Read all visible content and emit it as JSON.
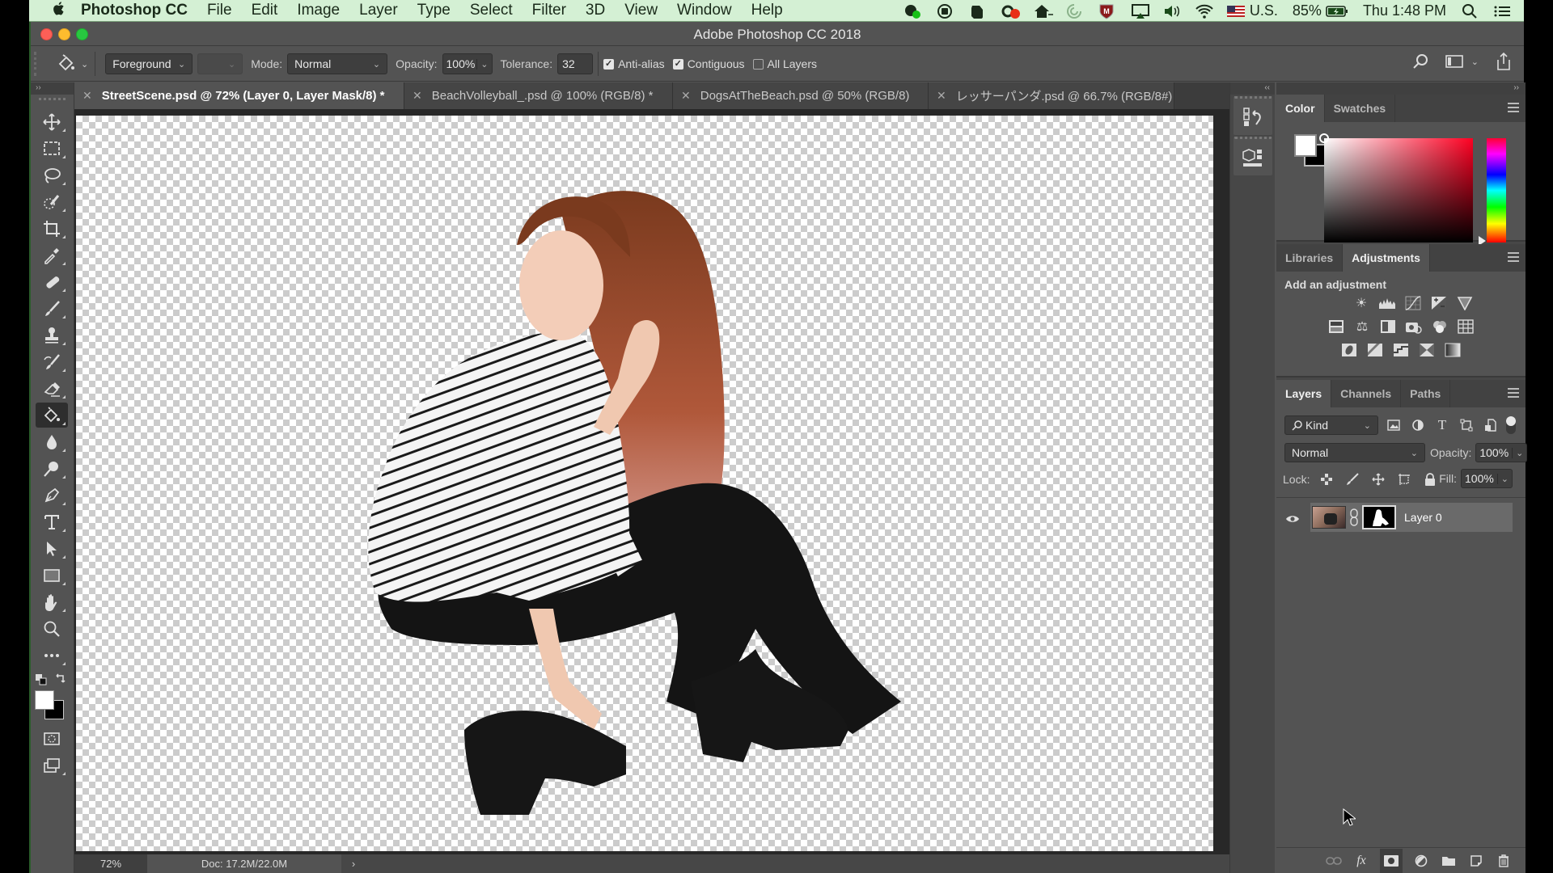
{
  "menubar": {
    "apple_icon": "apple-logo",
    "app_name": "Photoshop CC",
    "items": [
      "File",
      "Edit",
      "Image",
      "Layer",
      "Type",
      "Select",
      "Filter",
      "3D",
      "View",
      "Window",
      "Help"
    ],
    "status_icons": [
      "creative-cloud-chat-icon",
      "record-icon",
      "evernote-icon",
      "adobe-cc-icon",
      "home-network-icon",
      "spinner-icon",
      "mcafee-icon",
      "airplay-icon",
      "volume-icon",
      "wifi-icon"
    ],
    "input_source": "U.S.",
    "battery": "85%",
    "clock": "Thu 1:48 PM"
  },
  "window": {
    "title": "Adobe Photoshop CC 2018"
  },
  "options": {
    "tool_icon": "paint-bucket-icon",
    "fill_source": "Foreground",
    "mode_label": "Mode:",
    "mode_value": "Normal",
    "opacity_label": "Opacity:",
    "opacity_value": "100%",
    "tolerance_label": "Tolerance:",
    "tolerance_value": "32",
    "anti_alias_label": "Anti-alias",
    "anti_alias_checked": true,
    "contiguous_label": "Contiguous",
    "contiguous_checked": true,
    "all_layers_label": "All Layers",
    "all_layers_checked": false
  },
  "tabs": [
    {
      "label": "StreetScene.psd @ 72% (Layer 0, Layer Mask/8) *",
      "active": true
    },
    {
      "label": "BeachVolleyball_.psd @ 100% (RGB/8) *",
      "active": false
    },
    {
      "label": "DogsAtTheBeach.psd @ 50% (RGB/8)",
      "active": false
    },
    {
      "label": "レッサーパンダ.psd @ 66.7% (RGB/8#)",
      "active": false
    }
  ],
  "tools": [
    "move-tool",
    "marquee-tool",
    "lasso-tool",
    "quick-selection-tool",
    "crop-tool",
    "eyedropper-tool",
    "healing-brush-tool",
    "brush-tool",
    "clone-stamp-tool",
    "history-brush-tool",
    "eraser-tool",
    "paint-bucket-tool",
    "blur-tool",
    "dodge-tool",
    "pen-tool",
    "type-tool",
    "path-selection-tool",
    "rectangle-tool",
    "hand-tool",
    "zoom-tool",
    "more-tools"
  ],
  "selected_tool": "paint-bucket-tool",
  "status": {
    "zoom": "72%",
    "doc": "Doc: 17.2M/22.0M",
    "arrow": "›"
  },
  "color_panel": {
    "tabs": [
      "Color",
      "Swatches"
    ],
    "active_tab": "Color",
    "foreground": "#ffffff",
    "background": "#000000",
    "hue_color": "#ff0022"
  },
  "adjustments_panel": {
    "tabs": [
      "Libraries",
      "Adjustments"
    ],
    "active_tab": "Adjustments",
    "heading": "Add an adjustment",
    "rows": [
      [
        "brightness-contrast",
        "levels",
        "curves",
        "exposure",
        "vibrance"
      ],
      [
        "hue-saturation",
        "color-balance",
        "black-white",
        "photo-filter",
        "channel-mixer",
        "color-lookup"
      ],
      [
        "invert",
        "posterize",
        "threshold",
        "selective-color",
        "gradient-map"
      ]
    ]
  },
  "layers_panel": {
    "tabs": [
      "Layers",
      "Channels",
      "Paths"
    ],
    "active_tab": "Layers",
    "filter_label": "Kind",
    "blend_mode": "Normal",
    "opacity_label": "Opacity:",
    "opacity_value": "100%",
    "lock_label": "Lock:",
    "fill_label": "Fill:",
    "fill_value": "100%",
    "layers": [
      {
        "name": "Layer 0",
        "visible": true,
        "has_mask": true
      }
    ],
    "footer_icons": [
      "link-layers-icon",
      "fx-icon",
      "add-mask-icon",
      "adjustment-layer-icon",
      "group-folder-icon",
      "new-layer-icon",
      "trash-icon"
    ]
  }
}
